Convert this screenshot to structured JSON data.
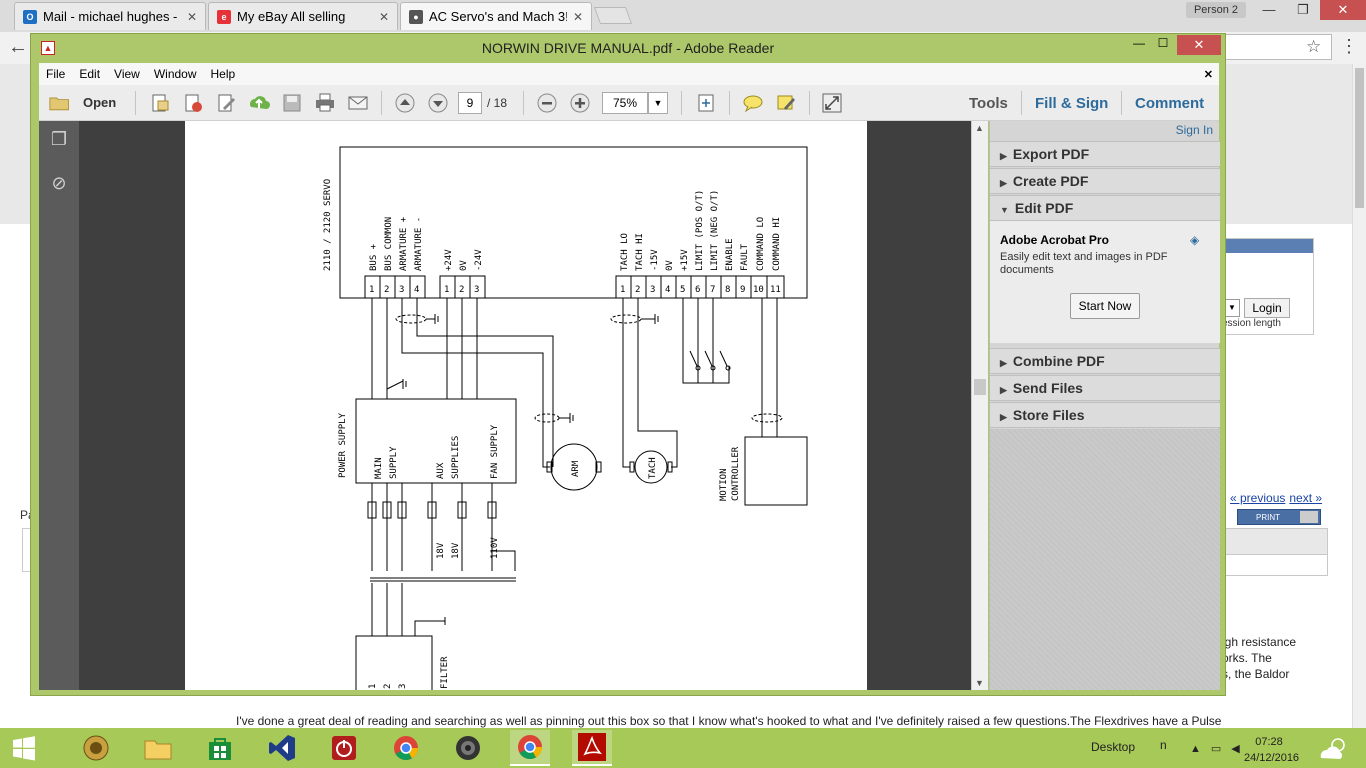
{
  "browser": {
    "tabs": [
      {
        "label": "Mail - michael hughes - ©",
        "icon_color": "#1f6fc5",
        "icon_letter": "O"
      },
      {
        "label": "My eBay All selling",
        "icon_color": "#e53238",
        "icon_letter": "e"
      },
      {
        "label": "AC Servo's and Mach 3!",
        "icon_color": "#555555",
        "icon_letter": "●"
      }
    ],
    "person": "Person 2"
  },
  "webpage": {
    "login_button": "Login",
    "session_text": "ession length",
    "pager": {
      "previous": "« previous",
      "next": "next »"
    },
    "print_button": "PRINT",
    "left_fragment": "Pa",
    "body_text": [
      "igh resistance",
      "orks. The",
      "s, the Baldor"
    ],
    "bottom_text": "I've done a great deal of reading and searching as well as pinning out this box so that I know what's hooked to what and I've definitely raised a few questions.The Flexdrives have a Pulse"
  },
  "reader": {
    "title": "NORWIN DRIVE MANUAL.pdf - Adobe Reader",
    "menu": [
      "File",
      "Edit",
      "View",
      "Window",
      "Help"
    ],
    "toolbar": {
      "open_label": "Open",
      "page_current": "9",
      "page_total": "/ 18",
      "zoom": "75%",
      "tools_link": "Tools",
      "fill_sign_link": "Fill & Sign",
      "comment_link": "Comment"
    },
    "right_pane": {
      "sign_in": "Sign In",
      "sections": [
        "Export PDF",
        "Create PDF",
        "Edit PDF",
        "Combine PDF",
        "Send Files",
        "Store Files"
      ],
      "edit_pdf": {
        "product": "Adobe Acrobat Pro",
        "description": "Easily edit text and images in PDF documents",
        "button": "Start Now"
      }
    },
    "diagram": {
      "title": "2110 / 2120 SERVO",
      "left_terminals": [
        {
          "num": "1",
          "label": "BUS +"
        },
        {
          "num": "2",
          "label": "BUS COMMON"
        },
        {
          "num": "3",
          "label": "ARMATURE +"
        },
        {
          "num": "4",
          "label": "ARMATURE -"
        }
      ],
      "aux_terminals": [
        {
          "num": "1",
          "label": "+24V"
        },
        {
          "num": "2",
          "label": "0V"
        },
        {
          "num": "3",
          "label": "-24V"
        }
      ],
      "signal_terminals": [
        {
          "num": "1",
          "label": "TACH LO"
        },
        {
          "num": "2",
          "label": "TACH HI"
        },
        {
          "num": "3",
          "label": "-15V"
        },
        {
          "num": "4",
          "label": "0V"
        },
        {
          "num": "5",
          "label": "+15V"
        },
        {
          "num": "6",
          "label": "LIMIT (POS O/T)"
        },
        {
          "num": "7",
          "label": "LIMIT (NEG O/T)"
        },
        {
          "num": "8",
          "label": "ENABLE"
        },
        {
          "num": "9",
          "label": "FAULT"
        },
        {
          "num": "10",
          "label": "COMMAND LO"
        },
        {
          "num": "11",
          "label": "COMMAND HI"
        }
      ],
      "power_supply": "POWER SUPPLY",
      "main_supply": [
        "MAIN",
        "SUPPLY"
      ],
      "aux_supplies": [
        "AUX",
        "SUPPLIES"
      ],
      "fan_supply": "FAN SUPPLY",
      "arm": "ARM",
      "tach": "TACH",
      "motion_controller": [
        "MOTION",
        "CONTROLLER"
      ],
      "windings": [
        "18V",
        "18V",
        "110V"
      ],
      "filter": "FILTER",
      "filter_terminals": [
        "1",
        "2",
        "3"
      ]
    }
  },
  "taskbar": {
    "desktop_label": "Desktop",
    "n_label": "n",
    "time": "07:28",
    "date": "24/12/2016"
  }
}
